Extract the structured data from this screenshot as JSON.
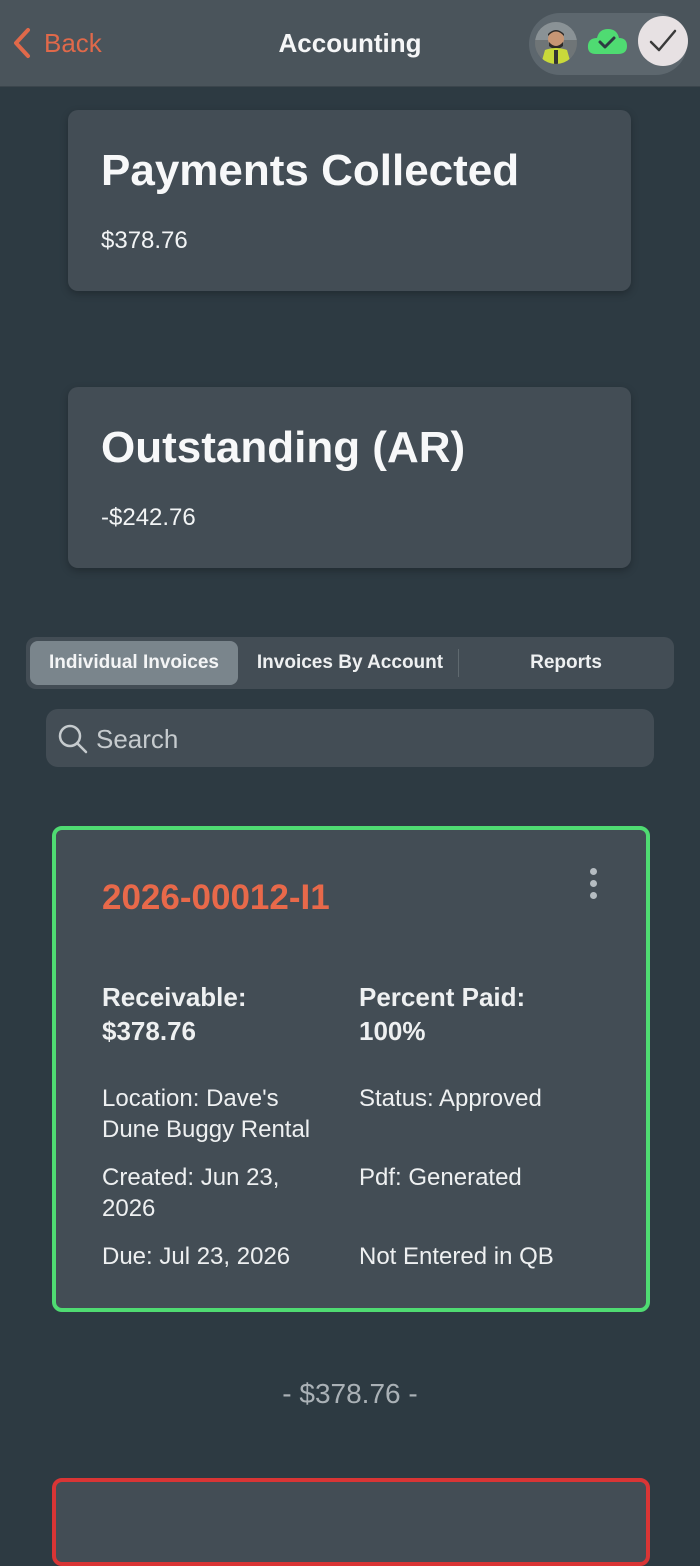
{
  "header": {
    "back_label": "Back",
    "title": "Accounting",
    "icons": [
      "chevron-left-icon",
      "avatar",
      "cloud-check-icon",
      "checkmark-icon"
    ],
    "colors": {
      "accent": "#e0694a",
      "cloud": "#4fdb72"
    }
  },
  "summary": {
    "payments_title": "Payments Collected",
    "payments_amount": "$378.76",
    "outstanding_title": "Outstanding (AR)",
    "outstanding_amount": "-$242.76"
  },
  "tabs": [
    {
      "label": "Individual Invoices",
      "active": true
    },
    {
      "label": "Invoices By Account",
      "active": false
    },
    {
      "label": "Reports",
      "active": false
    }
  ],
  "search": {
    "placeholder": "Search"
  },
  "invoices": [
    {
      "number": "2026-00012-I1",
      "receivable_label": "Receivable:",
      "receivable_value": "$378.76",
      "percent_label": "Percent Paid:",
      "percent_value": "100%",
      "location_line1": "Location: Dave's",
      "location_line2": "Dune Buggy Rental",
      "status": "Status: Approved",
      "created_line1": "Created: Jun 23,",
      "created_line2": "2026",
      "pdf": "Pdf: Generated",
      "due": "Due: Jul 23, 2026",
      "qb": "Not Entered in QB",
      "border_color": "#4fdb72"
    }
  ],
  "group_total": "- $378.76 -",
  "next_invoice_border_color": "#d93535"
}
